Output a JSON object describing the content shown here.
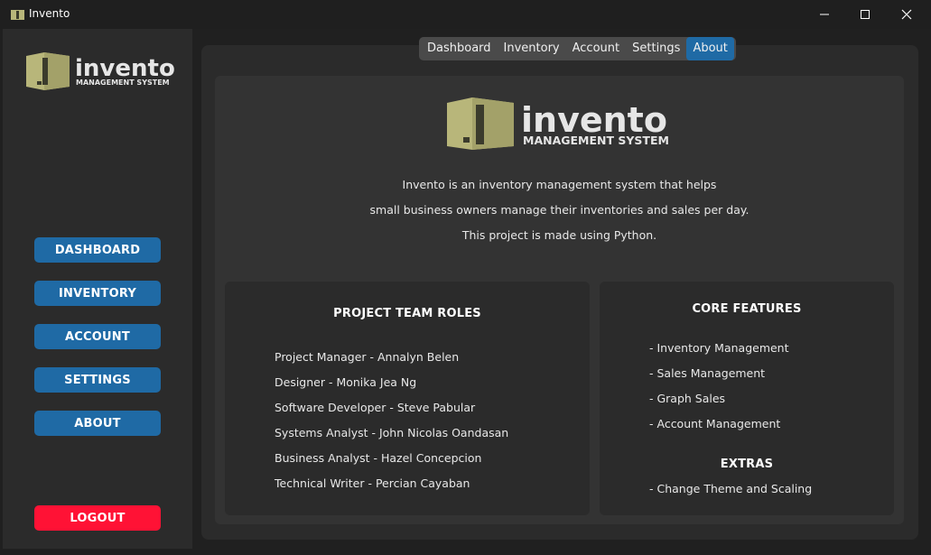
{
  "window": {
    "title": "Invento",
    "minimize_icon": "minimize-icon",
    "maximize_icon": "maximize-icon",
    "close_icon": "close-icon"
  },
  "logo": {
    "name": "invento",
    "tagline": "MANAGEMENT SYSTEM"
  },
  "sidebar": {
    "buttons": [
      {
        "label": "DASHBOARD"
      },
      {
        "label": "INVENTORY"
      },
      {
        "label": "ACCOUNT"
      },
      {
        "label": "SETTINGS"
      },
      {
        "label": "ABOUT"
      }
    ],
    "logout_label": "LOGOUT"
  },
  "tabs": [
    {
      "label": "Dashboard",
      "active": false
    },
    {
      "label": "Inventory",
      "active": false
    },
    {
      "label": "Account",
      "active": false
    },
    {
      "label": "Settings",
      "active": false
    },
    {
      "label": "About",
      "active": true
    }
  ],
  "about": {
    "description": [
      "Invento is an inventory management system that helps",
      "small business owners manage their inventories and sales per day.",
      "This project is made using Python."
    ],
    "team": {
      "title": "PROJECT TEAM ROLES",
      "members": [
        "Project Manager - Annalyn Belen",
        "Designer - Monika Jea Ng",
        "Software Developer - Steve Pabular",
        "Systems Analyst - John Nicolas Oandasan",
        "Business Analyst - Hazel Concepcion",
        "Technical Writer - Percian Cayaban"
      ]
    },
    "features": {
      "title": "CORE FEATURES",
      "items": [
        "- Inventory Management",
        "- Sales Management",
        "- Graph Sales",
        "- Account Management"
      ],
      "extras_title": "EXTRAS",
      "extras": [
        "- Change Theme and Scaling"
      ]
    }
  },
  "colors": {
    "accent": "#1f6aa5",
    "logout": "#ff1235",
    "logo_box": "#b8b67a",
    "background": "#202020",
    "panel": "#2b2b2b"
  }
}
